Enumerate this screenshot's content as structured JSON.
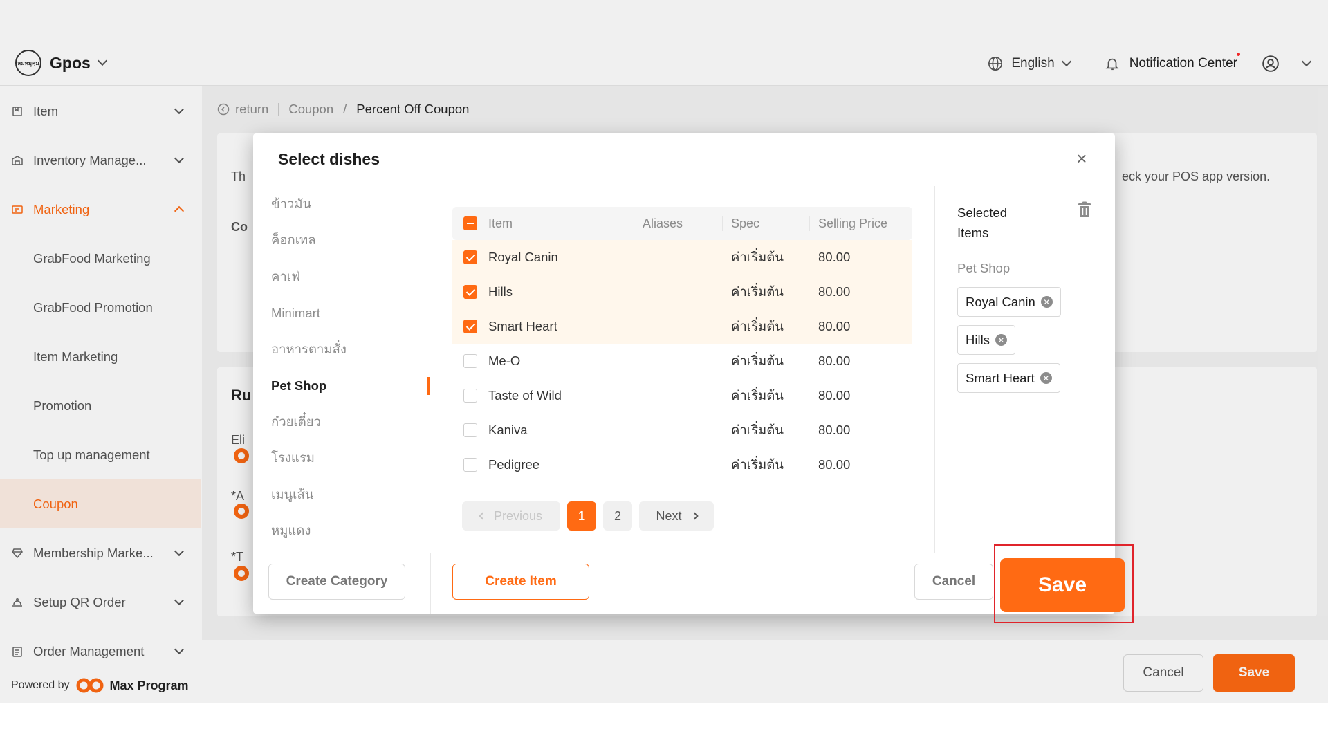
{
  "header": {
    "brand": "Gpos",
    "logo_text": "สมหมูคุม",
    "language": "English",
    "notification": "Notification Center"
  },
  "sidebar": {
    "items": [
      {
        "label": "Item",
        "icon": "bookmark-icon"
      },
      {
        "label": "Inventory Manage...",
        "icon": "warehouse-icon"
      },
      {
        "label": "Marketing",
        "icon": "ticket-icon"
      },
      {
        "label": "GrabFood Marketing"
      },
      {
        "label": "GrabFood Promotion"
      },
      {
        "label": "Item Marketing"
      },
      {
        "label": "Promotion"
      },
      {
        "label": "Top up management"
      },
      {
        "label": "Coupon"
      },
      {
        "label": "Membership Marke...",
        "icon": "gem-icon"
      },
      {
        "label": "Setup QR Order",
        "icon": "hat-icon"
      },
      {
        "label": "Order Management",
        "icon": "clipboard-icon"
      }
    ],
    "powered_by": "Powered by",
    "powered_brand": "Max Program"
  },
  "breadcrumb": {
    "return": "return",
    "parent": "Coupon",
    "separator": "/",
    "current": "Percent Off Coupon"
  },
  "background": {
    "card1_text": "Th",
    "card1_note": "eck your POS app version.",
    "card1_label": "Co",
    "card2_title": "Ru",
    "label_el": "Eli",
    "label_a": "*A",
    "label_t": "*T",
    "cancel": "Cancel",
    "save": "Save"
  },
  "modal": {
    "title": "Select dishes",
    "categories": [
      "ข้าวมัน",
      "ค็อกเทล",
      "คาเฟ่",
      "Minimart",
      "อาหารตามสั่ง",
      "Pet Shop",
      "ก๋วยเตี๋ยว",
      "โรงแรม",
      "เมนูเส้น",
      "หมูแดง"
    ],
    "table": {
      "headers": {
        "item": "Item",
        "aliases": "Aliases",
        "spec": "Spec",
        "price": "Selling Price"
      },
      "rows": [
        {
          "item": "Royal Canin",
          "aliases": "",
          "spec": "ค่าเริ่มต้น",
          "price": "80.00",
          "checked": true
        },
        {
          "item": "Hills",
          "aliases": "",
          "spec": "ค่าเริ่มต้น",
          "price": "80.00",
          "checked": true
        },
        {
          "item": "Smart Heart",
          "aliases": "",
          "spec": "ค่าเริ่มต้น",
          "price": "80.00",
          "checked": true
        },
        {
          "item": "Me-O",
          "aliases": "",
          "spec": "ค่าเริ่มต้น",
          "price": "80.00",
          "checked": false
        },
        {
          "item": "Taste of Wild",
          "aliases": "",
          "spec": "ค่าเริ่มต้น",
          "price": "80.00",
          "checked": false
        },
        {
          "item": "Kaniva",
          "aliases": "",
          "spec": "ค่าเริ่มต้น",
          "price": "80.00",
          "checked": false
        },
        {
          "item": "Pedigree",
          "aliases": "",
          "spec": "ค่าเริ่มต้น",
          "price": "80.00",
          "checked": false
        }
      ]
    },
    "pagination": {
      "previous": "Previous",
      "pages": [
        "1",
        "2"
      ],
      "current": "1",
      "next": "Next"
    },
    "selected": {
      "title": "Selected Items",
      "group": "Pet Shop",
      "tags": [
        "Royal Canin",
        "Hills",
        "Smart Heart"
      ]
    },
    "footer": {
      "create_category": "Create Category",
      "create_item": "Create Item",
      "cancel": "Cancel",
      "save": "Save"
    }
  },
  "colors": {
    "accent": "#ff6a13",
    "selected_bg": "#fff0e6",
    "highlight": "#e0242b"
  }
}
